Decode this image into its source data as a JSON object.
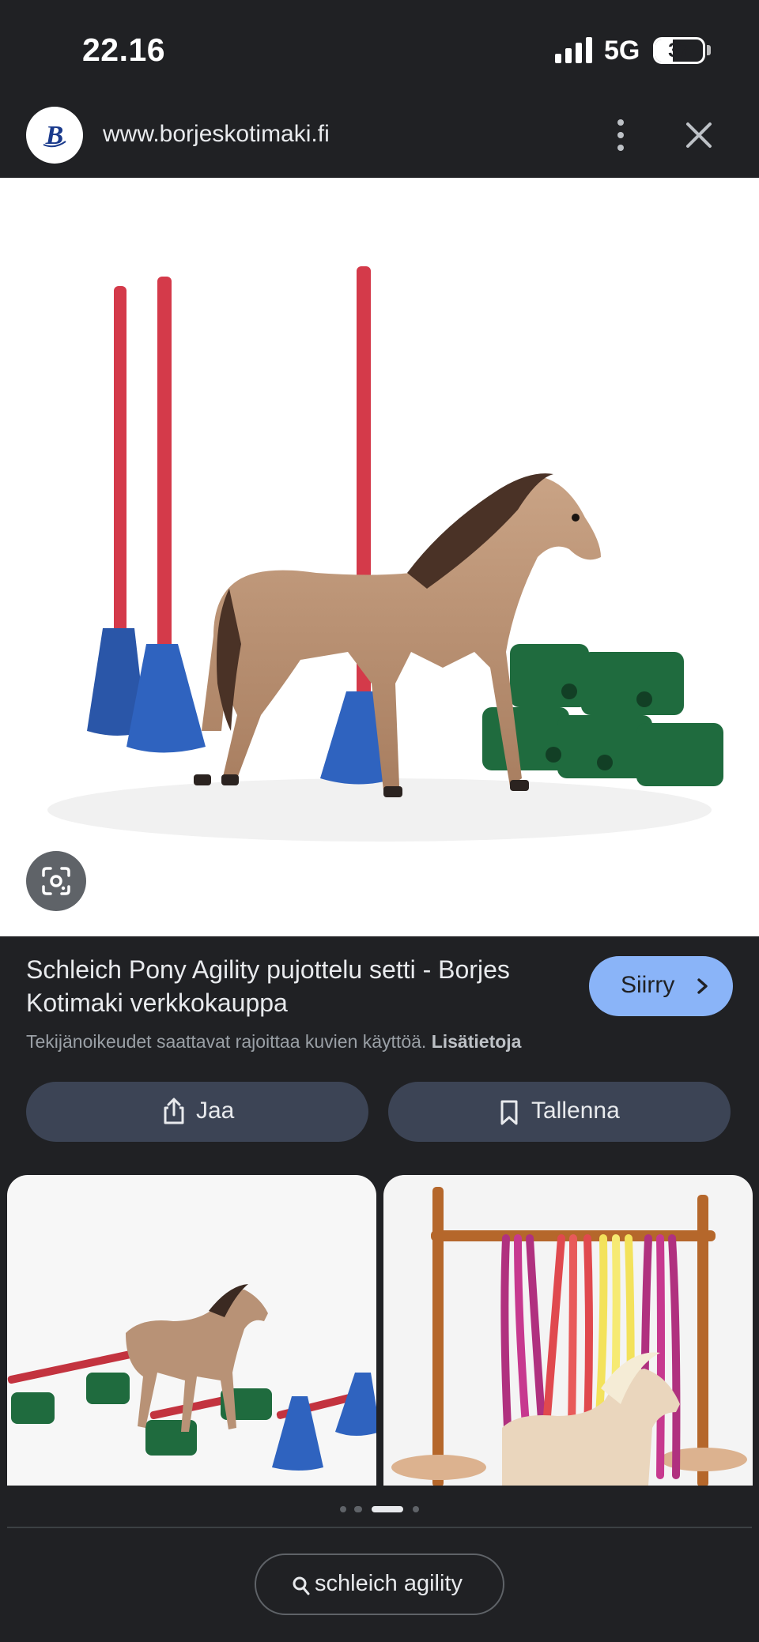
{
  "status_bar": {
    "time": "22.16",
    "network": "5G",
    "battery": "37",
    "battery_level": 0.37
  },
  "site_header": {
    "url": "www.borjeskotimaki.fi"
  },
  "result": {
    "title": "Schleich Pony Agility pujottelu setti - Borjes Kotimaki verkkokauppa",
    "visit_label": "Siirry",
    "copyright_text": "Tekijänoikeudet saattavat rajoittaa kuvien käyttöä.",
    "more_info_label": "Lisätietoja",
    "share_label": "Jaa",
    "save_label": "Tallenna"
  },
  "related": {
    "pager_active_index": 2,
    "pager_count": 4
  },
  "search": {
    "query": "schleich agility"
  },
  "colors": {
    "background": "#202124",
    "accent_button": "#8ab4f8",
    "action_button": "#3c4455"
  }
}
